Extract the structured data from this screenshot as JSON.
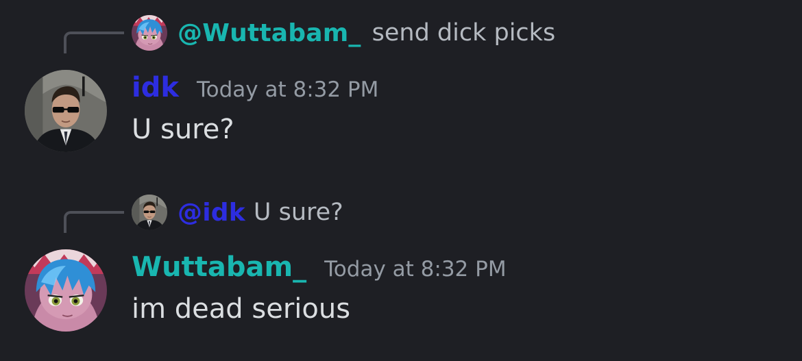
{
  "colors": {
    "background": "#1e1f24",
    "user_idk": "#2d2de0",
    "user_wuttabam": "#19b6b0",
    "text": "#dbdee1",
    "muted": "#949ba4",
    "reply_text": "#b5bac1"
  },
  "messages": [
    {
      "reply": {
        "avatar_icon": "anime-avatar-icon",
        "mention": "@Wuttabam_",
        "text": "send dick picks"
      },
      "avatar_icon": "sunglasses-man-avatar-icon",
      "username": "idk",
      "timestamp": "Today at 8:32 PM",
      "content": "U sure?"
    },
    {
      "reply": {
        "avatar_icon": "sunglasses-man-avatar-icon",
        "mention": "@idk",
        "text": "U sure?"
      },
      "avatar_icon": "anime-avatar-icon",
      "username": "Wuttabam_",
      "timestamp": "Today at 8:32 PM",
      "content": "im dead serious"
    }
  ]
}
